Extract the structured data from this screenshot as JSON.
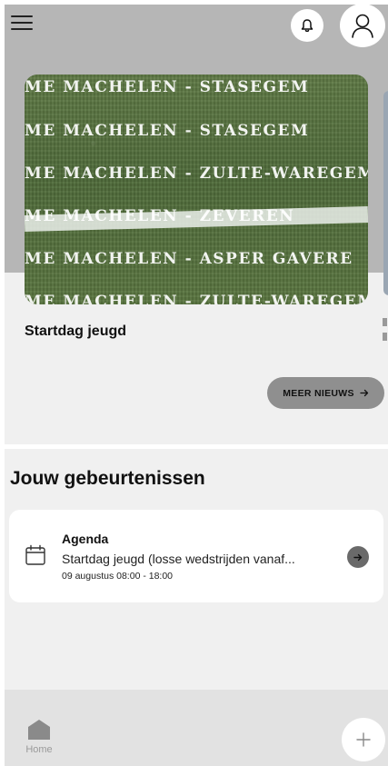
{
  "header": {
    "menu_icon": "hamburger-menu-icon",
    "bell_icon": "bell-icon",
    "avatar_icon": "user-icon"
  },
  "news": {
    "card_lines": [
      "ME MACHELEN -  STASEGEM",
      "ME MACHELEN -  STASEGEM",
      "ME MACHELEN - ZULTE-WAREGEM",
      "ME MACHELEN - ZEVEREN",
      "ME MACHELEN - ASPER GAVERE",
      "ME MACHELEN - ZULTE-WAREGEM"
    ],
    "card_title": "Startdag jeugd",
    "more_button_label": "MEER NIEUWS",
    "more_button_icon": "arrow-right-icon"
  },
  "events": {
    "section_title": "Jouw gebeurtenissen",
    "items": [
      {
        "label": "Agenda",
        "description": "Startdag jeugd (losse wedstrijden vanaf...",
        "time": "09 augustus 08:00 - 18:00",
        "icon": "calendar-icon"
      }
    ]
  },
  "bottom_nav": {
    "home_label": "Home",
    "home_icon": "home-icon",
    "fab_icon": "plus-icon"
  }
}
